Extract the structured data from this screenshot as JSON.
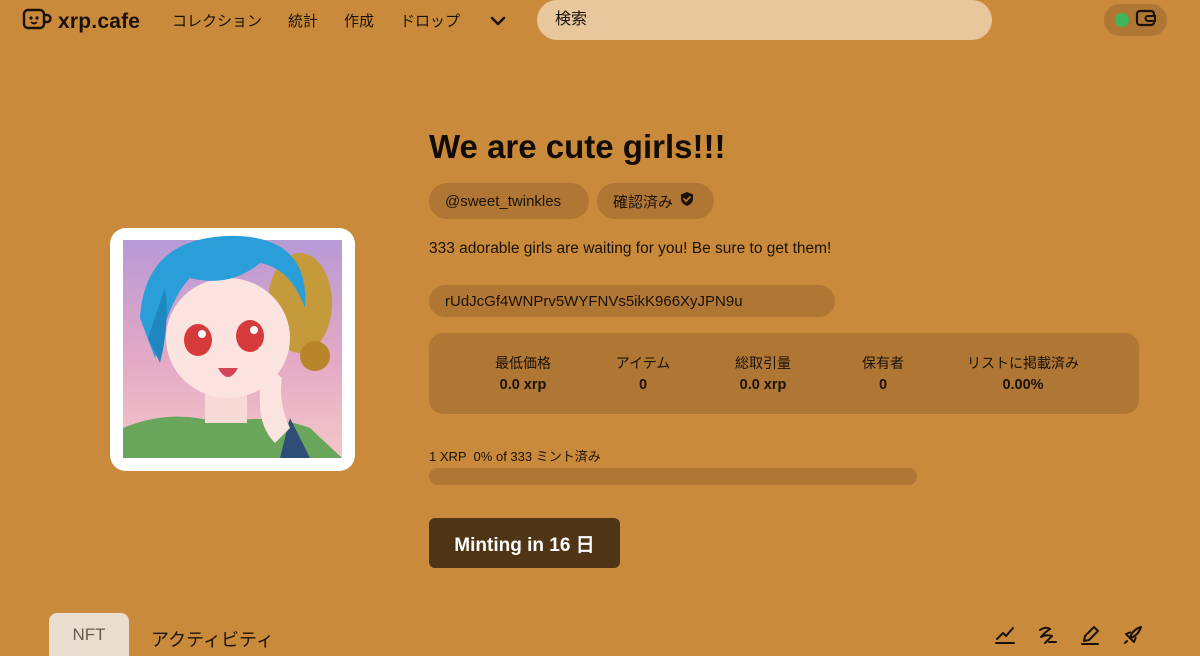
{
  "header": {
    "logo_text": "xrp.cafe",
    "nav": [
      "コレクション",
      "統計",
      "作成",
      "ドロップ"
    ],
    "search_placeholder": "検索",
    "wallet_status_color": "#3cb55c"
  },
  "collection": {
    "title": "We are cute girls!!!",
    "creator": "@sweet_twinkles",
    "verified_label": "確認済み",
    "description": "333 adorable girls are waiting for you! Be sure to get them!",
    "address": "rUdJcGf4WNPrv5WYFNVs5ikK966XyJPN9u"
  },
  "stats": [
    {
      "label": "最低価格",
      "value": "0.0 xrp"
    },
    {
      "label": "アイテム",
      "value": "0"
    },
    {
      "label": "総取引量",
      "value": "0.0 xrp"
    },
    {
      "label": "保有者",
      "value": "0"
    },
    {
      "label": "リストに掲載済み",
      "value": "0.00%"
    }
  ],
  "mint": {
    "info": "1 XRP  0% of 333 ミント済み",
    "progress_percent": 0,
    "button_label": "Minting in 16 日"
  },
  "tabs": {
    "nft": "NFT",
    "activity": "アクティビティ"
  },
  "toolbar_icons": [
    "chart-line-icon",
    "sign-icon",
    "pencil-icon",
    "rocket-icon"
  ],
  "colors": {
    "background": "#c98a3c",
    "panel": "#b07634",
    "button": "#4f3515"
  }
}
